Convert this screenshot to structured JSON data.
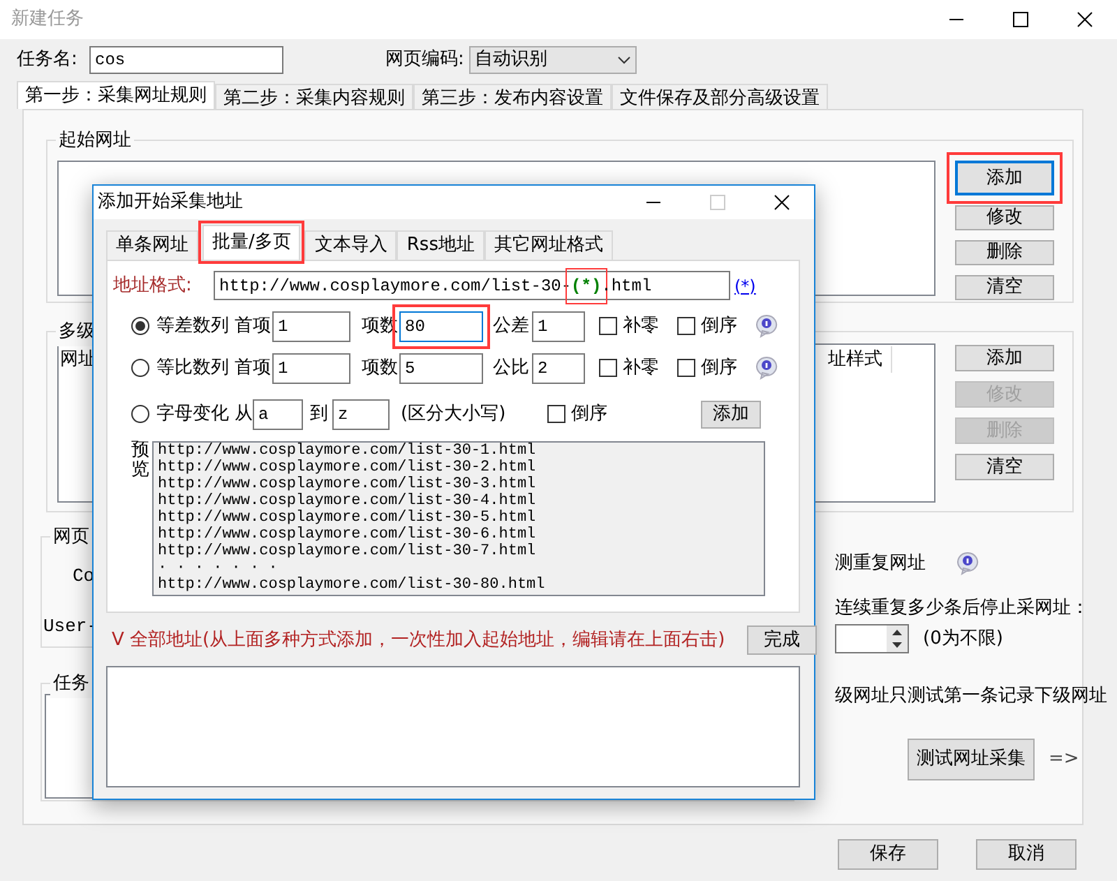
{
  "window": {
    "title": "新建任务"
  },
  "task_name": {
    "label": "任务名:",
    "value": "cos"
  },
  "encoding": {
    "label": "网页编码:",
    "value": "自动识别"
  },
  "tabs": [
    {
      "label": "第一步：采集网址规则",
      "selected": true
    },
    {
      "label": "第二步：采集内容规则",
      "selected": false
    },
    {
      "label": "第三步：发布内容设置",
      "selected": false
    },
    {
      "label": "文件保存及部分高级设置",
      "selected": false
    }
  ],
  "start_urls": {
    "title": "起始网址",
    "buttons": [
      {
        "label": "添加",
        "disabled": false,
        "focused": true
      },
      {
        "label": "修改",
        "disabled": false,
        "focused": false
      },
      {
        "label": "删除",
        "disabled": false,
        "focused": false
      },
      {
        "label": "清空",
        "disabled": false,
        "focused": false
      }
    ]
  },
  "multi_level": {
    "title": "多级",
    "column_1": "网址",
    "column_2": "址样式",
    "buttons": [
      {
        "label": "添加",
        "disabled": false,
        "focused": false
      },
      {
        "label": "修改",
        "disabled": true,
        "focused": false
      },
      {
        "label": "删除",
        "disabled": true,
        "focused": false
      },
      {
        "label": "清空",
        "disabled": false,
        "focused": false
      }
    ]
  },
  "login": {
    "title": "网页",
    "line_1": "Co",
    "line_2": "User-"
  },
  "options": {
    "detect_label": "测重复网址",
    "stop_label": "连续重复多少条后停止采网址：",
    "stop_hint": "(0为不限)",
    "test_label": "级网址只测试第一条记录下级网址",
    "test_button": "测试网址采集",
    "arrow": "=>"
  },
  "notes": {
    "title": "任务"
  },
  "footer_buttons": [
    "保存",
    "取消"
  ],
  "dialog": {
    "title": "添加开始采集地址",
    "tabs": [
      {
        "label": "单条网址",
        "selected": false
      },
      {
        "label": "批量/多页",
        "selected": true
      },
      {
        "label": "文本导入",
        "selected": false
      },
      {
        "label": "Rss地址",
        "selected": false
      },
      {
        "label": "其它网址格式",
        "selected": false
      }
    ],
    "format_label": "地址格式:",
    "format_prefix": "http://www.cosplaymore.com/list-30-",
    "format_wildcard": "(*)",
    "format_suffix": ".html",
    "wildcard_link": "(*)",
    "rows": [
      {
        "kind": "numeric",
        "selected": true,
        "label": "等差数列",
        "first_label": "首项",
        "first": "1",
        "count_label": "项数",
        "count": "80",
        "step_label": "公差",
        "step": "1",
        "zero_pad": {
          "label": "补零",
          "checked": false
        },
        "reverse": {
          "label": "倒序",
          "checked": false
        }
      },
      {
        "kind": "numeric",
        "selected": false,
        "label": "等比数列",
        "first_label": "首项",
        "first": "1",
        "count_label": "项数",
        "count": "5",
        "step_label": "公比",
        "step": "2",
        "zero_pad": {
          "label": "补零",
          "checked": false
        },
        "reverse": {
          "label": "倒序",
          "checked": false
        }
      },
      {
        "kind": "letters",
        "selected": false,
        "label": "字母变化",
        "from_label": "从",
        "from": "a",
        "to_label": "到",
        "to": "z",
        "note": "(区分大小写)",
        "reverse": {
          "label": "倒序",
          "checked": false
        },
        "button": "添加"
      }
    ],
    "preview_label": "预览",
    "preview": [
      "http://www.cosplaymore.com/list-30-1.html",
      "http://www.cosplaymore.com/list-30-2.html",
      "http://www.cosplaymore.com/list-30-3.html",
      "http://www.cosplaymore.com/list-30-4.html",
      "http://www.cosplaymore.com/list-30-5.html",
      "http://www.cosplaymore.com/list-30-6.html",
      "http://www.cosplaymore.com/list-30-7.html",
      "· · · · · · ·",
      "http://www.cosplaymore.com/list-30-80.html"
    ],
    "all_label": "V  全部地址(从上面多种方式添加，一次性加入起始地址，编辑请在上面右击)",
    "done_button": "完成"
  }
}
